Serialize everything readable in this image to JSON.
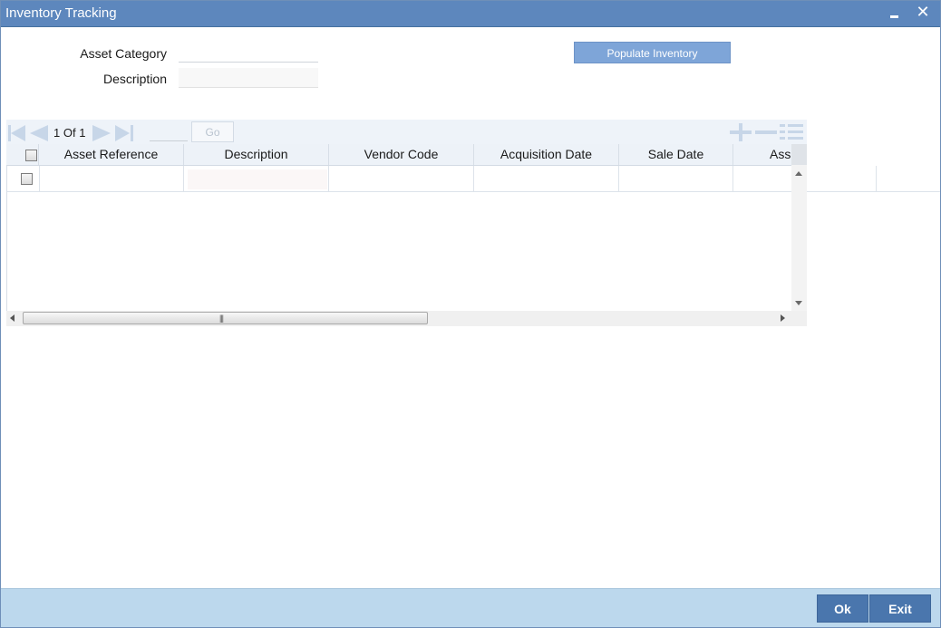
{
  "window": {
    "title": "Inventory Tracking",
    "minimize_icon": "minimize-icon",
    "close_icon": "close-icon"
  },
  "form": {
    "asset_category_label": "Asset Category",
    "asset_category_value": "",
    "description_label": "Description",
    "description_value": "",
    "populate_button": "Populate Inventory"
  },
  "grid": {
    "pagination": {
      "current_page": "1",
      "of_label": "Of",
      "total_pages": "1",
      "page_input": "",
      "go_label": "Go"
    },
    "columns": [
      "Asset Reference",
      "Description",
      "Vendor Code",
      "Acquisition Date",
      "Sale Date",
      "Ass"
    ],
    "rows": [
      {
        "asset_reference": "",
        "description": "",
        "vendor_code": "",
        "acquisition_date": "",
        "sale_date": "",
        "ass": ""
      }
    ]
  },
  "footer": {
    "ok_label": "Ok",
    "exit_label": "Exit"
  },
  "colors": {
    "titlebar": "#5d87bd",
    "accent_button": "#4a76ad",
    "footer": "#bcd8ed",
    "populate_button": "#7ea5d8"
  }
}
